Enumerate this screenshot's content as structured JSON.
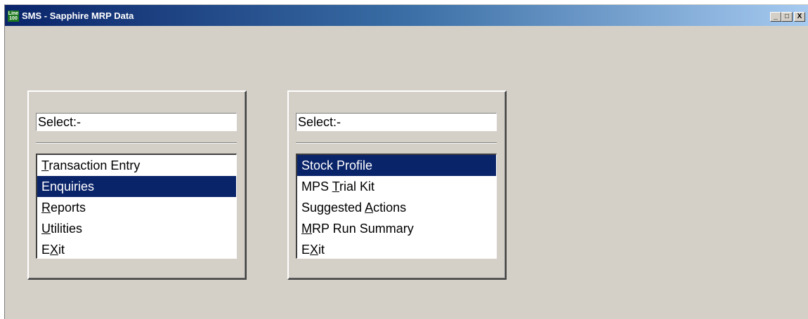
{
  "window": {
    "title": "SMS - Sapphire MRP Data",
    "icon_text_top": "Line",
    "icon_text_bottom": "100",
    "controls": {
      "minimize": "_",
      "maximize": "□",
      "close": "X"
    }
  },
  "panels": [
    {
      "select_label": "Select:-",
      "items": [
        {
          "pre": "",
          "key": "T",
          "post": "ransaction Entry",
          "selected": false
        },
        {
          "pre": "",
          "key": "E",
          "post": "nquiries",
          "selected": true
        },
        {
          "pre": "",
          "key": "R",
          "post": "eports",
          "selected": false
        },
        {
          "pre": "",
          "key": "U",
          "post": "tilities",
          "selected": false
        },
        {
          "pre": "E",
          "key": "X",
          "post": "it",
          "selected": false
        }
      ]
    },
    {
      "select_label": "Select:-",
      "items": [
        {
          "pre": "",
          "key": "S",
          "post": "tock Profile",
          "selected": true
        },
        {
          "pre": "MPS ",
          "key": "T",
          "post": "rial Kit",
          "selected": false
        },
        {
          "pre": "Suggested ",
          "key": "A",
          "post": "ctions",
          "selected": false
        },
        {
          "pre": "",
          "key": "M",
          "post": "RP Run Summary",
          "selected": false
        },
        {
          "pre": "E",
          "key": "X",
          "post": "it",
          "selected": false
        }
      ]
    }
  ],
  "colors": {
    "selection": "#0a246a",
    "face": "#d4d0c8",
    "title_start": "#0a246a",
    "title_end": "#a6caf0"
  }
}
